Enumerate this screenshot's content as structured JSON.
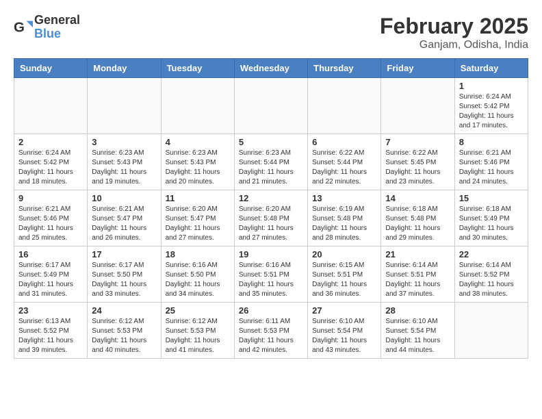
{
  "logo": {
    "general": "General",
    "blue": "Blue"
  },
  "title": "February 2025",
  "subtitle": "Ganjam, Odisha, India",
  "days_of_week": [
    "Sunday",
    "Monday",
    "Tuesday",
    "Wednesday",
    "Thursday",
    "Friday",
    "Saturday"
  ],
  "weeks": [
    [
      {
        "day": "",
        "info": ""
      },
      {
        "day": "",
        "info": ""
      },
      {
        "day": "",
        "info": ""
      },
      {
        "day": "",
        "info": ""
      },
      {
        "day": "",
        "info": ""
      },
      {
        "day": "",
        "info": ""
      },
      {
        "day": "1",
        "info": "Sunrise: 6:24 AM\nSunset: 5:42 PM\nDaylight: 11 hours and 17 minutes."
      }
    ],
    [
      {
        "day": "2",
        "info": "Sunrise: 6:24 AM\nSunset: 5:42 PM\nDaylight: 11 hours and 18 minutes."
      },
      {
        "day": "3",
        "info": "Sunrise: 6:23 AM\nSunset: 5:43 PM\nDaylight: 11 hours and 19 minutes."
      },
      {
        "day": "4",
        "info": "Sunrise: 6:23 AM\nSunset: 5:43 PM\nDaylight: 11 hours and 20 minutes."
      },
      {
        "day": "5",
        "info": "Sunrise: 6:23 AM\nSunset: 5:44 PM\nDaylight: 11 hours and 21 minutes."
      },
      {
        "day": "6",
        "info": "Sunrise: 6:22 AM\nSunset: 5:44 PM\nDaylight: 11 hours and 22 minutes."
      },
      {
        "day": "7",
        "info": "Sunrise: 6:22 AM\nSunset: 5:45 PM\nDaylight: 11 hours and 23 minutes."
      },
      {
        "day": "8",
        "info": "Sunrise: 6:21 AM\nSunset: 5:46 PM\nDaylight: 11 hours and 24 minutes."
      }
    ],
    [
      {
        "day": "9",
        "info": "Sunrise: 6:21 AM\nSunset: 5:46 PM\nDaylight: 11 hours and 25 minutes."
      },
      {
        "day": "10",
        "info": "Sunrise: 6:21 AM\nSunset: 5:47 PM\nDaylight: 11 hours and 26 minutes."
      },
      {
        "day": "11",
        "info": "Sunrise: 6:20 AM\nSunset: 5:47 PM\nDaylight: 11 hours and 27 minutes."
      },
      {
        "day": "12",
        "info": "Sunrise: 6:20 AM\nSunset: 5:48 PM\nDaylight: 11 hours and 27 minutes."
      },
      {
        "day": "13",
        "info": "Sunrise: 6:19 AM\nSunset: 5:48 PM\nDaylight: 11 hours and 28 minutes."
      },
      {
        "day": "14",
        "info": "Sunrise: 6:18 AM\nSunset: 5:48 PM\nDaylight: 11 hours and 29 minutes."
      },
      {
        "day": "15",
        "info": "Sunrise: 6:18 AM\nSunset: 5:49 PM\nDaylight: 11 hours and 30 minutes."
      }
    ],
    [
      {
        "day": "16",
        "info": "Sunrise: 6:17 AM\nSunset: 5:49 PM\nDaylight: 11 hours and 31 minutes."
      },
      {
        "day": "17",
        "info": "Sunrise: 6:17 AM\nSunset: 5:50 PM\nDaylight: 11 hours and 33 minutes."
      },
      {
        "day": "18",
        "info": "Sunrise: 6:16 AM\nSunset: 5:50 PM\nDaylight: 11 hours and 34 minutes."
      },
      {
        "day": "19",
        "info": "Sunrise: 6:16 AM\nSunset: 5:51 PM\nDaylight: 11 hours and 35 minutes."
      },
      {
        "day": "20",
        "info": "Sunrise: 6:15 AM\nSunset: 5:51 PM\nDaylight: 11 hours and 36 minutes."
      },
      {
        "day": "21",
        "info": "Sunrise: 6:14 AM\nSunset: 5:51 PM\nDaylight: 11 hours and 37 minutes."
      },
      {
        "day": "22",
        "info": "Sunrise: 6:14 AM\nSunset: 5:52 PM\nDaylight: 11 hours and 38 minutes."
      }
    ],
    [
      {
        "day": "23",
        "info": "Sunrise: 6:13 AM\nSunset: 5:52 PM\nDaylight: 11 hours and 39 minutes."
      },
      {
        "day": "24",
        "info": "Sunrise: 6:12 AM\nSunset: 5:53 PM\nDaylight: 11 hours and 40 minutes."
      },
      {
        "day": "25",
        "info": "Sunrise: 6:12 AM\nSunset: 5:53 PM\nDaylight: 11 hours and 41 minutes."
      },
      {
        "day": "26",
        "info": "Sunrise: 6:11 AM\nSunset: 5:53 PM\nDaylight: 11 hours and 42 minutes."
      },
      {
        "day": "27",
        "info": "Sunrise: 6:10 AM\nSunset: 5:54 PM\nDaylight: 11 hours and 43 minutes."
      },
      {
        "day": "28",
        "info": "Sunrise: 6:10 AM\nSunset: 5:54 PM\nDaylight: 11 hours and 44 minutes."
      },
      {
        "day": "",
        "info": ""
      }
    ]
  ]
}
